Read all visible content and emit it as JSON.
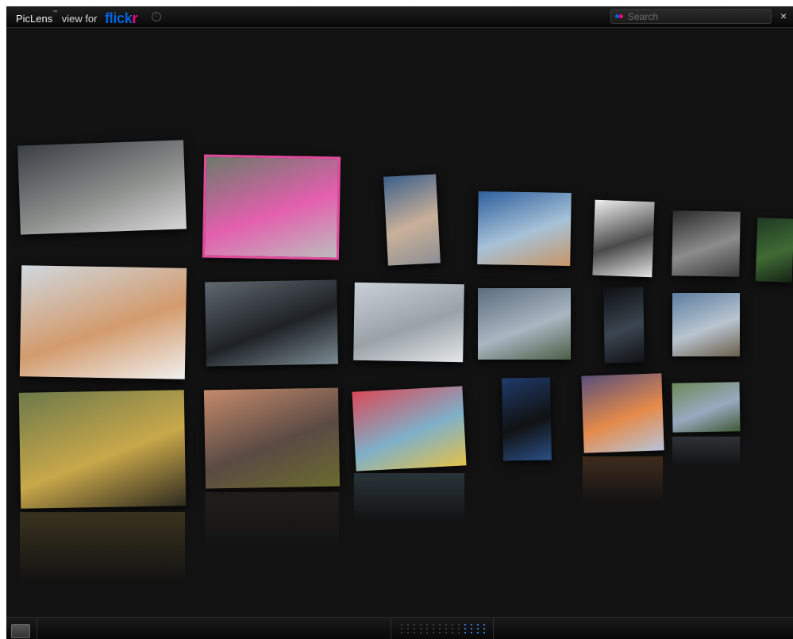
{
  "app": {
    "brand_name": "PicLens",
    "trademark": "™",
    "brand_suffix": "view for",
    "service_blue": "flick",
    "service_pink": "r",
    "info_icon": "i"
  },
  "search": {
    "placeholder": "Search",
    "value": ""
  },
  "window": {
    "close_glyph": "×"
  },
  "colors": {
    "background": "#121212",
    "flickr_blue": "#0063dc",
    "flickr_pink": "#ff0084",
    "selection": "#e24a9c",
    "pager_active": "#2f7bd9"
  },
  "gallery": {
    "rows": [
      [
        {
          "name": "thumb-house-storm",
          "c1": "#3a3f46",
          "c2": "#8a8c8a",
          "c3": "#d6d6d6",
          "selected": false
        },
        {
          "name": "thumb-pink-mustang",
          "c1": "#6c7a6a",
          "c2": "#e45fae",
          "c3": "#bdbdbd",
          "selected": true
        },
        {
          "name": "thumb-couple-airstream",
          "c1": "#3d5f8a",
          "c2": "#c9b19a",
          "c3": "#8d8f95",
          "selected": false
        },
        {
          "name": "thumb-bride-desert",
          "c1": "#2e5f9e",
          "c2": "#a7c2d8",
          "c3": "#c79566",
          "selected": false
        },
        {
          "name": "thumb-bw-woman-hood",
          "c1": "#f0f0f0",
          "c2": "#4a4a4a",
          "c3": "#e5e5e5",
          "selected": false
        },
        {
          "name": "thumb-bw-portrait",
          "c1": "#2a2a2a",
          "c2": "#8c8c8c",
          "c3": "#3a3a3a",
          "selected": false
        },
        {
          "name": "thumb-green-woman",
          "c1": "#1f3a24",
          "c2": "#3f6b34",
          "c3": "#162316",
          "selected": false
        }
      ],
      [
        {
          "name": "thumb-bed-couple",
          "c1": "#cfd8e0",
          "c2": "#d39b6c",
          "c3": "#f0f0f0",
          "selected": false
        },
        {
          "name": "thumb-car-parking",
          "c1": "#606870",
          "c2": "#1e2226",
          "c3": "#7c8a93",
          "selected": false
        },
        {
          "name": "thumb-street-walker",
          "c1": "#c9d1d8",
          "c2": "#9aa2a8",
          "c3": "#e3e6e8",
          "selected": false
        },
        {
          "name": "thumb-foggy-city",
          "c1": "#5b6c7c",
          "c2": "#aab6c2",
          "c3": "#4b5e46",
          "selected": false
        },
        {
          "name": "thumb-dark-window",
          "c1": "#0d0f12",
          "c2": "#3b4550",
          "c3": "#0f1114",
          "selected": false
        },
        {
          "name": "thumb-cloud-gate",
          "c1": "#5c7da2",
          "c2": "#b9c5cf",
          "c3": "#6a5d4c",
          "selected": false
        }
      ],
      [
        {
          "name": "thumb-bee-flower",
          "c1": "#6d7a4a",
          "c2": "#c9a84a",
          "c3": "#2e2b1f",
          "selected": false
        },
        {
          "name": "thumb-tree-sunset",
          "c1": "#c48a6a",
          "c2": "#5a4a44",
          "c3": "#6b6b2e",
          "selected": false
        },
        {
          "name": "thumb-stamps-collage",
          "c1": "#d94a5a",
          "c2": "#7fb0c9",
          "c3": "#e3c14a",
          "selected": false
        },
        {
          "name": "thumb-band-night",
          "c1": "#1f3b6a",
          "c2": "#111111",
          "c3": "#2a4f86",
          "selected": false
        },
        {
          "name": "thumb-ice-sunset",
          "c1": "#5a4f7a",
          "c2": "#e58a4a",
          "c3": "#b8c4d8",
          "selected": false
        },
        {
          "name": "thumb-market-stall",
          "c1": "#6a8a5a",
          "c2": "#9aa9c0",
          "c3": "#3f5a35",
          "selected": false
        }
      ]
    ]
  },
  "footer": {
    "pager_cols": 14,
    "pager_rows": 3,
    "active_from_col": 10
  }
}
